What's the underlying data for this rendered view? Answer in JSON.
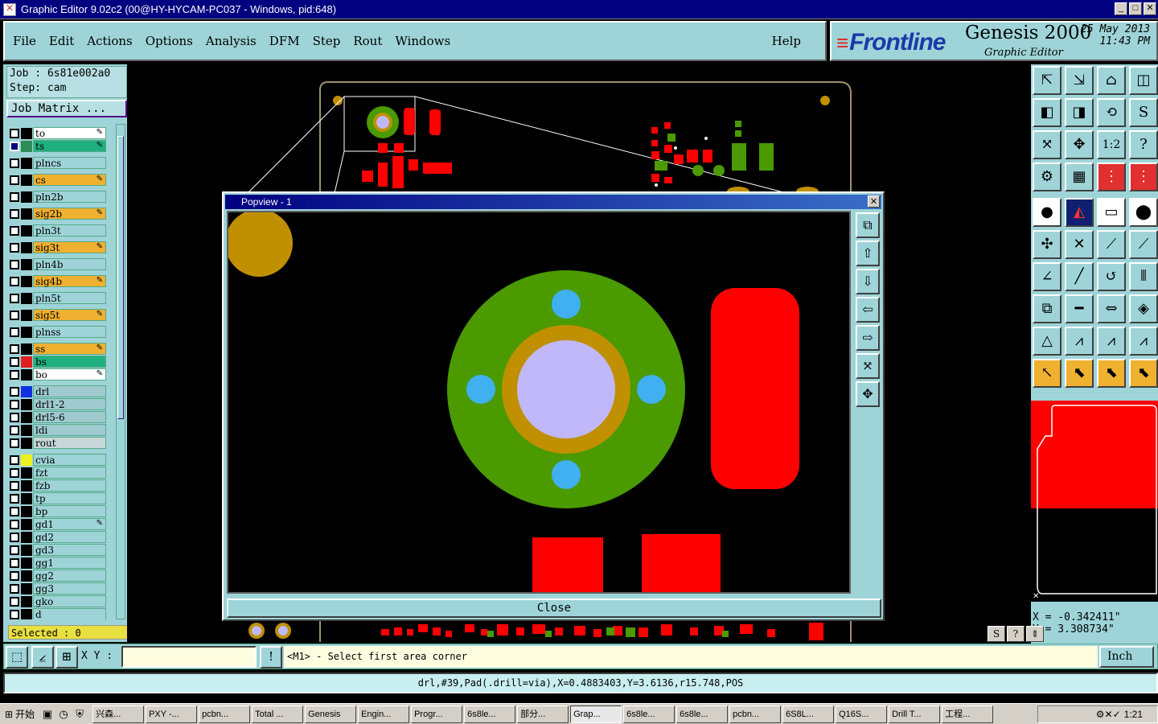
{
  "window": {
    "title": "Graphic Editor 9.02c2 (00@HY-HYCAM-PC037 - Windows, pid:648)"
  },
  "menu": {
    "items": [
      "File",
      "Edit",
      "Actions",
      "Options",
      "Analysis",
      "DFM",
      "Step",
      "Rout",
      "Windows"
    ],
    "help": "Help"
  },
  "brand": {
    "logo": "Frontline",
    "product": "Genesis 2000",
    "subtitle": "Graphic Editor",
    "date": "25 May 2013",
    "time": "11:43 PM"
  },
  "job": {
    "job_line": "Job : 6s81e002a0",
    "step_line": "Step: cam",
    "matrix_button": "Job Matrix ..."
  },
  "layers": [
    {
      "name": "to",
      "color": "#000000",
      "bg": "#ffffff",
      "edit": true
    },
    {
      "name": "ts",
      "color": "#2e8b57",
      "bg": "#20b080",
      "edit": true,
      "active": true
    },
    {
      "name": "plncs",
      "color": "#000000",
      "bg": "#9ed4d8",
      "edit": false
    },
    {
      "name": "cs",
      "color": "#000000",
      "bg": "#f0b030",
      "edit": true
    },
    {
      "name": "pln2b",
      "color": "#000000",
      "bg": "#9ed4d8",
      "edit": false
    },
    {
      "name": "sig2b",
      "color": "#000000",
      "bg": "#f0b030",
      "edit": true
    },
    {
      "name": "pln3t",
      "color": "#000000",
      "bg": "#9ed4d8",
      "edit": false
    },
    {
      "name": "sig3t",
      "color": "#000000",
      "bg": "#f0b030",
      "edit": true
    },
    {
      "name": "pln4b",
      "color": "#000000",
      "bg": "#9ed4d8",
      "edit": false
    },
    {
      "name": "sig4b",
      "color": "#000000",
      "bg": "#f0b030",
      "edit": true
    },
    {
      "name": "pln5t",
      "color": "#000000",
      "bg": "#9ed4d8",
      "edit": false
    },
    {
      "name": "sig5t",
      "color": "#000000",
      "bg": "#f0b030",
      "edit": true
    },
    {
      "name": "plnss",
      "color": "#000000",
      "bg": "#9ed4d8",
      "edit": false
    },
    {
      "name": "ss",
      "color": "#000000",
      "bg": "#f0b030",
      "edit": true
    },
    {
      "name": "bs",
      "color": "#e02020",
      "bg": "#20b080",
      "edit": false
    },
    {
      "name": "bo",
      "color": "#000000",
      "bg": "#ffffff",
      "edit": true
    },
    {
      "name": "drl",
      "color": "#1030e0",
      "bg": "#9ecad0",
      "edit": false
    },
    {
      "name": "drl1-2",
      "color": "#000000",
      "bg": "#9ecad0",
      "edit": false
    },
    {
      "name": "drl5-6",
      "color": "#000000",
      "bg": "#9ecad0",
      "edit": false
    },
    {
      "name": "ldi",
      "color": "#000000",
      "bg": "#9ecad0",
      "edit": false
    },
    {
      "name": "rout",
      "color": "#000000",
      "bg": "#c8d8d8",
      "edit": false
    },
    {
      "name": "cvia",
      "color": "#f0f020",
      "bg": "#9ed4d8",
      "edit": false
    },
    {
      "name": "fzt",
      "color": "#000000",
      "bg": "#9ed4d8",
      "edit": false
    },
    {
      "name": "fzb",
      "color": "#000000",
      "bg": "#9ed4d8",
      "edit": false
    },
    {
      "name": "tp",
      "color": "#000000",
      "bg": "#9ed4d8",
      "edit": false
    },
    {
      "name": "bp",
      "color": "#000000",
      "bg": "#9ed4d8",
      "edit": false
    },
    {
      "name": "gd1",
      "color": "#000000",
      "bg": "#9ed4d8",
      "edit": true
    },
    {
      "name": "gd2",
      "color": "#000000",
      "bg": "#9ed4d8",
      "edit": false
    },
    {
      "name": "gd3",
      "color": "#000000",
      "bg": "#9ed4d8",
      "edit": false
    },
    {
      "name": "gg1",
      "color": "#000000",
      "bg": "#9ed4d8",
      "edit": false
    },
    {
      "name": "gg2",
      "color": "#000000",
      "bg": "#9ed4d8",
      "edit": false
    },
    {
      "name": "gg3",
      "color": "#000000",
      "bg": "#9ed4d8",
      "edit": false
    },
    {
      "name": "gko",
      "color": "#000000",
      "bg": "#9ed4d8",
      "edit": false
    },
    {
      "name": "d",
      "color": "#000000",
      "bg": "#9ed4d8",
      "edit": false
    }
  ],
  "selected": "Selected : 0",
  "popview": {
    "title": "Popview - 1",
    "close": "Close"
  },
  "coords": {
    "x": "X = -0.342411\"",
    "y": "Y = 3.308734\""
  },
  "command": {
    "xy_label": "X Y :",
    "input_value": "",
    "prompt": "<M1> - Select first area corner",
    "unit": "Inch"
  },
  "status": "drl,#39,Pad(.drill=via),X=0.4883403,Y=3.6136,r15.748,POS",
  "taskbar": {
    "start": "开始",
    "tasks": [
      "兴森...",
      "PXY -...",
      "pcbn...",
      "Total ...",
      "Genesis",
      "Engin...",
      "Progr...",
      "6s8le...",
      "部分...",
      "Grap...",
      "6s8le...",
      "6s8le...",
      "pcbn...",
      "6S8L...",
      "Q16S...",
      "Drill T...",
      "工程..."
    ],
    "active_index": 9,
    "clock": "1:21"
  },
  "colors": {
    "teal": "#9ed4d8",
    "copper_red": "#ff0000",
    "mask_green": "#4a9a00",
    "gold": "#c09000",
    "drill_lavender": "#c0b8f8",
    "via_blue": "#40b0f0"
  }
}
